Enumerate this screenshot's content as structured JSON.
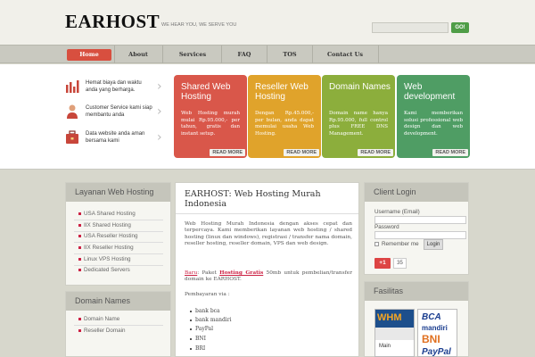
{
  "header": {
    "logo": "EARHOST",
    "tagline": "WE HEAR YOU, WE SERVE YOU",
    "search_button": "GO!"
  },
  "nav": {
    "items": [
      {
        "label": "Home"
      },
      {
        "label": "About"
      },
      {
        "label": "Services"
      },
      {
        "label": "FAQ"
      },
      {
        "label": "TOS"
      },
      {
        "label": "Contact Us"
      }
    ]
  },
  "features": [
    {
      "text": "Hemat biaya dan waktu anda yang berharga.",
      "icon": "bar-chart-icon"
    },
    {
      "text": "Customer Service kami siap membantu anda",
      "icon": "person-icon"
    },
    {
      "text": "Data website anda aman bersama kami",
      "icon": "briefcase-icon"
    }
  ],
  "boxes": [
    {
      "title": "Shared Web Hosting",
      "desc": "Web Hosting murah mulai Rp.95.000,- per tahun, gratis dan instant setup.",
      "more": "READ MORE",
      "color": "#d9574a"
    },
    {
      "title": "Reseller Web Hosting",
      "desc": "Dengan Rp.45.000,- per bulan, anda dapat memulai usaha Web Hosting.",
      "more": "READ MORE",
      "color": "#e0a32b"
    },
    {
      "title": "Domain Names",
      "desc": "Domain name hanya Rp.95.000, full control plus FREE DNS Management.",
      "more": "READ MORE",
      "color": "#8cae3c"
    },
    {
      "title": "Web development",
      "desc": "Kami memberikan solusi professional web design dan web development.",
      "more": "READ MORE",
      "color": "#4f9d64"
    }
  ],
  "sidebar_hosting": {
    "title": "Layanan Web Hosting",
    "items": [
      "USA Shared Hosting",
      "IIX Shared Hosting",
      "USA Reseller Hosting",
      "IIX Reseller Hosting",
      "Linux VPS Hosting",
      "Dedicated Servers"
    ]
  },
  "sidebar_domain": {
    "title": "Domain Names",
    "items": [
      "Domain Name",
      "Reseller Domain"
    ]
  },
  "main": {
    "title": "EARHOST: Web Hosting Murah Indonesia",
    "paragraph": "Web Hosting Murah Indonesia dengan akses cepat dan terpercaya. Kami memberikan layanan web hosting / shared hosting (linux dan windows), registrasi / transfer nama domain, reseller hosting, reseller domain, VPS dan web design.",
    "promo_new": "Baru",
    "promo_pre": ": Paket ",
    "promo_link": "Hosting Gratis",
    "promo_post": " 50mb untuk pembelian/transfer domain ke EARHOST.",
    "payment_label": "Pembayaran via :",
    "payments": [
      "bank bca",
      "bank mandiri",
      "PayPal",
      "BNI",
      "BRI"
    ]
  },
  "login": {
    "title": "Client Login",
    "username_label": "Username (Email)",
    "password_label": "Password",
    "remember_label": "Remember me",
    "login_button": "Login",
    "gplus_label": "+1",
    "gplus_count": "35"
  },
  "fasilitas": {
    "title": "Fasilitas",
    "whm_label": "WHM",
    "whm_main": "Main",
    "bank_labels": [
      "BCA",
      "mandiri",
      "BNI",
      "PayPal"
    ]
  }
}
